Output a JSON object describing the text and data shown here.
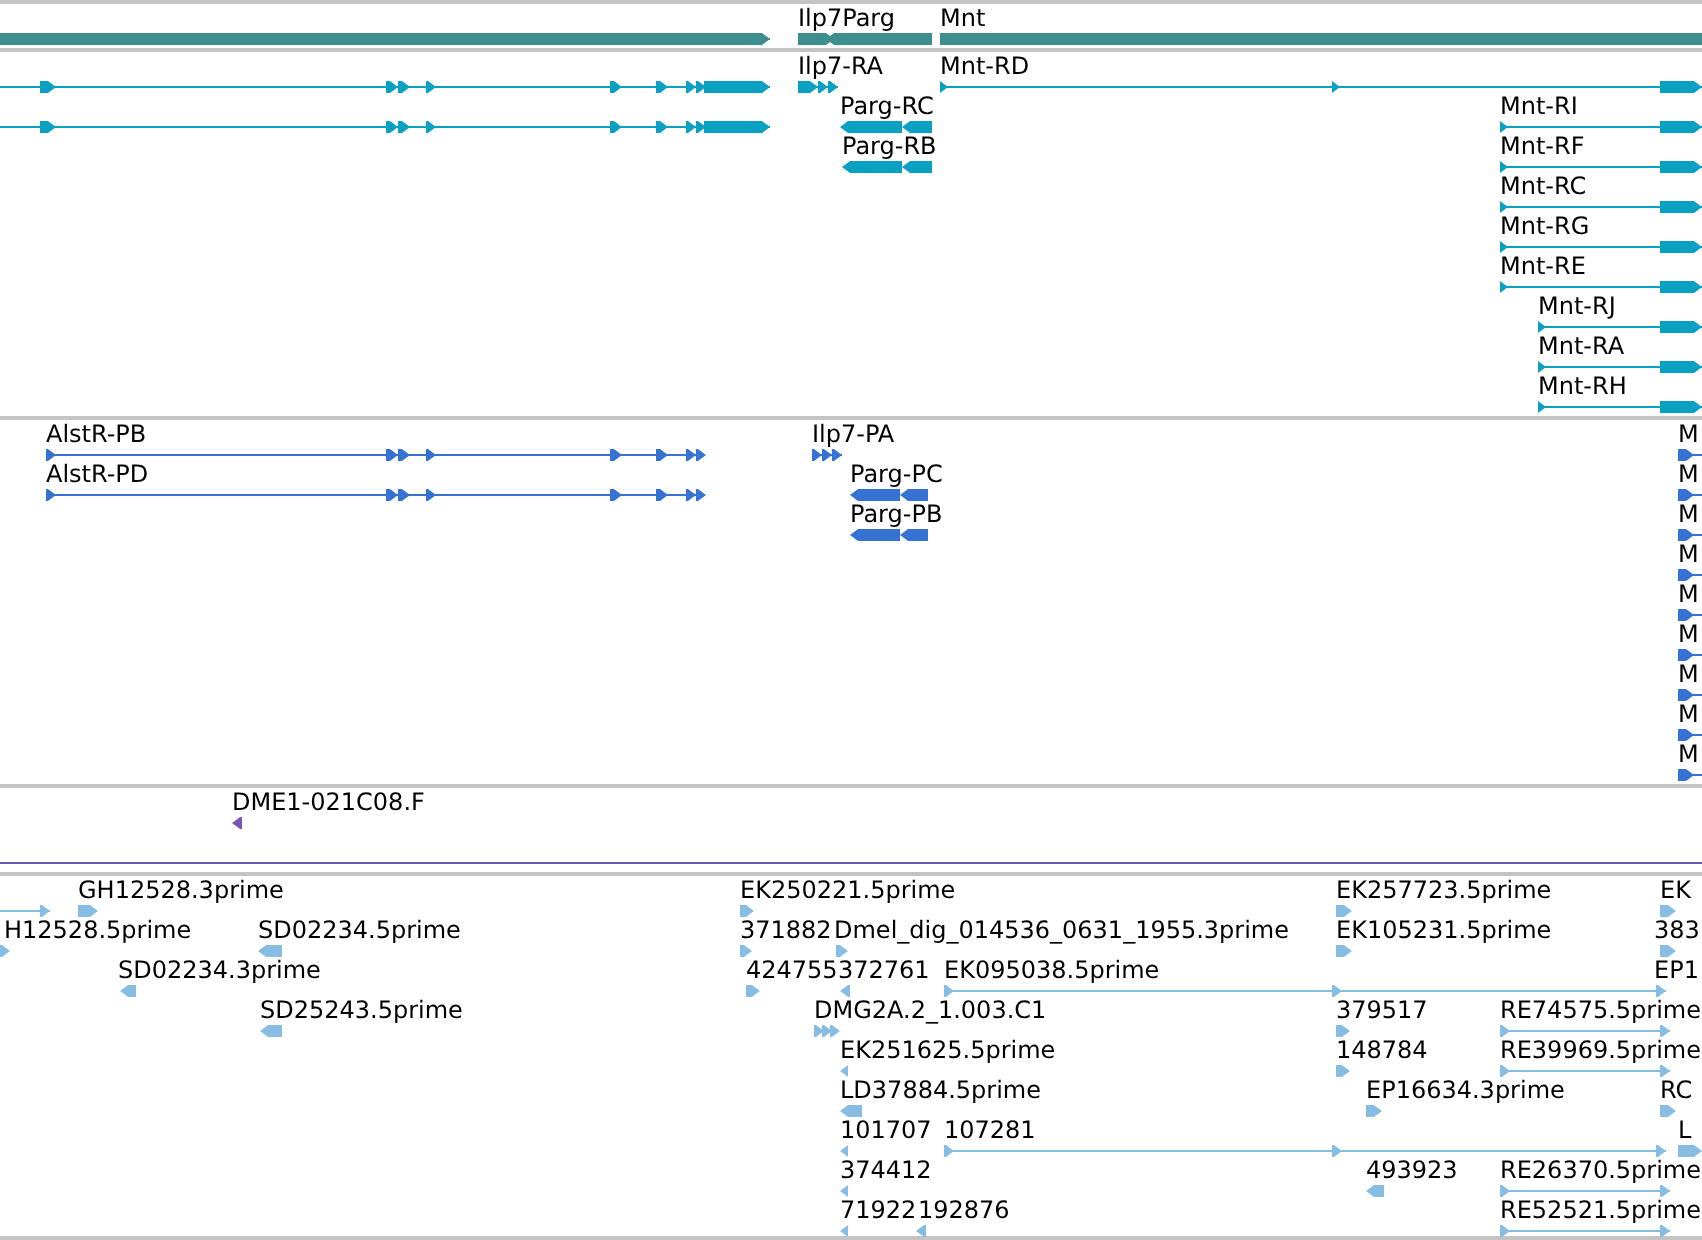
{
  "tracks": [
    {
      "kind": "gene",
      "color": "#3e8e90",
      "features": [
        {
          "reverse": false
        },
        {
          "label": "Ilp7Parg",
          "reverse": false
        },
        {
          "label": "Mnt",
          "reverse": false
        }
      ]
    },
    {
      "kind": "transcript",
      "color": "#0aa0c2",
      "features": [
        {
          "reverse": false
        },
        {
          "label": "Ilp7-RA",
          "reverse": false
        },
        {
          "label": "Mnt-RD",
          "reverse": false
        },
        {
          "reverse": false
        },
        {
          "label": "Parg-RC",
          "reverse": true
        },
        {
          "label": "Mnt-RI",
          "reverse": false
        },
        {
          "label": "Parg-RB",
          "reverse": true
        },
        {
          "label": "Mnt-RF",
          "reverse": false
        },
        {
          "label": "Mnt-RC",
          "reverse": false
        },
        {
          "label": "Mnt-RG",
          "reverse": false
        },
        {
          "label": "Mnt-RE",
          "reverse": false
        },
        {
          "label": "Mnt-RJ",
          "reverse": false
        },
        {
          "label": "Mnt-RA",
          "reverse": false
        },
        {
          "label": "Mnt-RH",
          "reverse": false
        }
      ]
    },
    {
      "kind": "protein",
      "color": "#3672d2",
      "features": [
        {
          "label": "AlstR-PB",
          "reverse": false
        },
        {
          "label": "Ilp7-PA",
          "reverse": false
        },
        {
          "label": "M",
          "reverse": false
        },
        {
          "label": "AlstR-PD",
          "reverse": false
        },
        {
          "label": "Parg-PC",
          "reverse": true
        },
        {
          "label": "M",
          "reverse": false
        },
        {
          "label": "Parg-PB",
          "reverse": true
        },
        {
          "label": "M",
          "reverse": false
        },
        {
          "label": "M",
          "reverse": false
        },
        {
          "label": "M",
          "reverse": false
        },
        {
          "label": "M",
          "reverse": false
        },
        {
          "label": "M",
          "reverse": false
        },
        {
          "label": "M",
          "reverse": false
        },
        {
          "label": "M",
          "reverse": false
        }
      ]
    },
    {
      "kind": "clone",
      "color": "#7a55b5",
      "features": [
        {
          "label": "DME1-021C08.F",
          "reverse": true
        }
      ]
    },
    {
      "kind": "est",
      "color": "#87bde2",
      "features": [
        {
          "reverse": false
        },
        {
          "label": "GH12528.3prime",
          "reverse": false
        },
        {
          "label": "EK250221.5prime",
          "reverse": false
        },
        {
          "label": "EK257723.5prime",
          "reverse": false
        },
        {
          "label": "EK",
          "reverse": false
        },
        {
          "label": "H12528.5prime",
          "reverse": false
        },
        {
          "label": "SD02234.5prime",
          "reverse": true
        },
        {
          "label": "371882",
          "reverse": false
        },
        {
          "label": "Dmel_dig_014536_0631_1955.3prime",
          "reverse": false
        },
        {
          "label": "EK105231.5prime",
          "reverse": false
        },
        {
          "label": "383",
          "reverse": false
        },
        {
          "label": "SD02234.3prime",
          "reverse": true
        },
        {
          "label": "424755",
          "reverse": false
        },
        {
          "label": "372761",
          "reverse": true
        },
        {
          "label": "EK095038.5prime",
          "reverse": false
        },
        {
          "label": "EP1"
        },
        {
          "label": "SD25243.5prime",
          "reverse": true
        },
        {
          "label": "DMG2A.2_1.003.C1",
          "reverse": false
        },
        {
          "label": "379517",
          "reverse": false
        },
        {
          "label": "RE74575.5prime",
          "reverse": false
        },
        {
          "label": "EK251625.5prime",
          "reverse": true
        },
        {
          "label": "148784",
          "reverse": false
        },
        {
          "label": "RE39969.5prime",
          "reverse": false
        },
        {
          "label": "LD37884.5prime",
          "reverse": true
        },
        {
          "label": "EP16634.3prime",
          "reverse": false
        },
        {
          "label": "RC",
          "reverse": false
        },
        {
          "label": "101707",
          "reverse": true
        },
        {
          "label": "107281",
          "reverse": false
        },
        {
          "label": "L",
          "reverse": false
        },
        {
          "label": "374412",
          "reverse": true
        },
        {
          "label": "493923",
          "reverse": true
        },
        {
          "label": "RE26370.5prime",
          "reverse": false
        },
        {
          "label": "71922",
          "reverse": true
        },
        {
          "label": "192876",
          "reverse": true
        },
        {
          "label": "RE52521.5prime",
          "reverse": false
        }
      ]
    }
  ]
}
